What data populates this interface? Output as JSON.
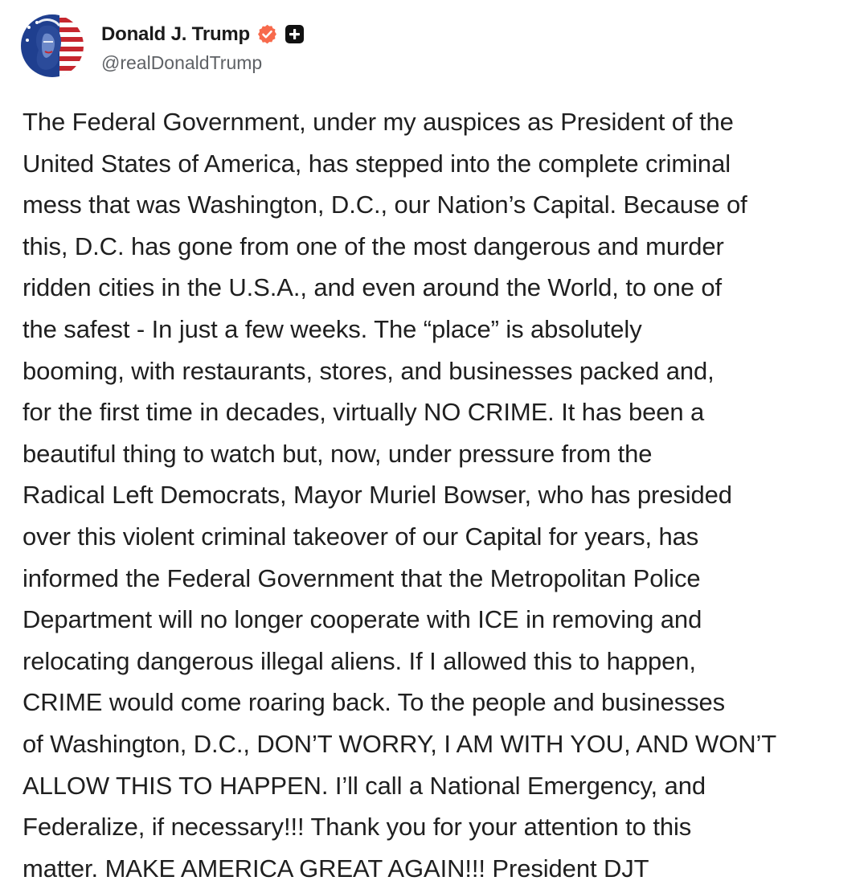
{
  "author": {
    "display_name": "Donald J. Trump",
    "handle": "@realDonaldTrump",
    "verified": true,
    "badges": [
      "verified-badge-icon",
      "plus-badge-icon"
    ],
    "badge_color": "#f76a4c"
  },
  "post": {
    "text": "The Federal Government, under my auspices as President of the\nUnited States of America, has stepped into the complete criminal\nmess that was Washington, D.C., our Nation’s Capital. Because of\nthis, D.C. has gone from one of the most dangerous and murder\nridden cities in the U.S.A., and even around the World, to one of\nthe safest - In just a few weeks. The “place” is absolutely\nbooming, with restaurants, stores, and businesses packed and,\nfor the first time in decades, virtually NO CRIME. It has been a\nbeautiful thing to watch but, now, under pressure from the\nRadical Left Democrats, Mayor Muriel Bowser, who has presided\nover this violent criminal takeover of our Capital for years, has\ninformed the Federal Government that the Metropolitan Police\nDepartment will no longer cooperate with ICE in removing and\nrelocating dangerous illegal aliens. If I allowed this to happen,\nCRIME would come roaring back. To the people and businesses\nof Washington, D.C., DON’T WORRY, I AM WITH YOU, AND WON’T\nALLOW THIS TO HAPPEN. I’ll call a National Emergency, and\nFederalize, if necessary!!! Thank you for your attention to this\nmatter. MAKE AMERICA GREAT AGAIN!!! President DJT"
  }
}
